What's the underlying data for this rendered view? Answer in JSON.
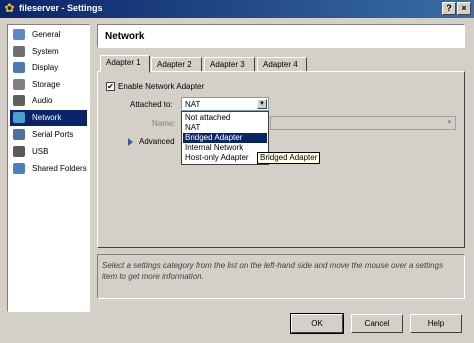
{
  "window": {
    "title": "fileserver - Settings",
    "icon": "settings-gear-icon",
    "controls": [
      "?",
      "×"
    ]
  },
  "sidebar": {
    "items": [
      {
        "label": "General",
        "icon": "general-icon",
        "color": "#5a8ac6"
      },
      {
        "label": "System",
        "icon": "system-icon",
        "color": "#707070"
      },
      {
        "label": "Display",
        "icon": "display-icon",
        "color": "#4a7ab0"
      },
      {
        "label": "Storage",
        "icon": "storage-icon",
        "color": "#808080"
      },
      {
        "label": "Audio",
        "icon": "audio-icon",
        "color": "#606060"
      },
      {
        "label": "Network",
        "icon": "network-icon",
        "color": "#4aa0d0",
        "selected": true
      },
      {
        "label": "Serial Ports",
        "icon": "serial-ports-icon",
        "color": "#5070a0"
      },
      {
        "label": "USB",
        "icon": "usb-icon",
        "color": "#5a5a5a"
      },
      {
        "label": "Shared Folders",
        "icon": "shared-folders-icon",
        "color": "#4a80c0"
      }
    ]
  },
  "header": {
    "title": "Network"
  },
  "tabs": [
    {
      "label": "Adapter 1",
      "active": true
    },
    {
      "label": "Adapter 2"
    },
    {
      "label": "Adapter 3"
    },
    {
      "label": "Adapter 4"
    }
  ],
  "adapter": {
    "enable_label": "Enable Network Adapter",
    "enable_checked": true,
    "check_mark": "✔",
    "attached_label": "Attached to:",
    "attached_value": "NAT",
    "name_label": "Name:",
    "advanced_label": "Advanced"
  },
  "dropdown": {
    "options": [
      "Not attached",
      "NAT",
      "Bridged Adapter",
      "Internal Network",
      "Host-only Adapter"
    ],
    "highlighted": "Bridged Adapter"
  },
  "tooltip": {
    "text": "Bridged Adapter"
  },
  "info": {
    "text": "Select a settings category from the list on the left-hand side and move the mouse over a settings item to get more information."
  },
  "buttons": {
    "ok": "OK",
    "cancel": "Cancel",
    "help": "Help"
  },
  "colors": {
    "selection": "#0a246a",
    "titlebar": "#0a246a",
    "tooltip": "#ffffe1"
  }
}
